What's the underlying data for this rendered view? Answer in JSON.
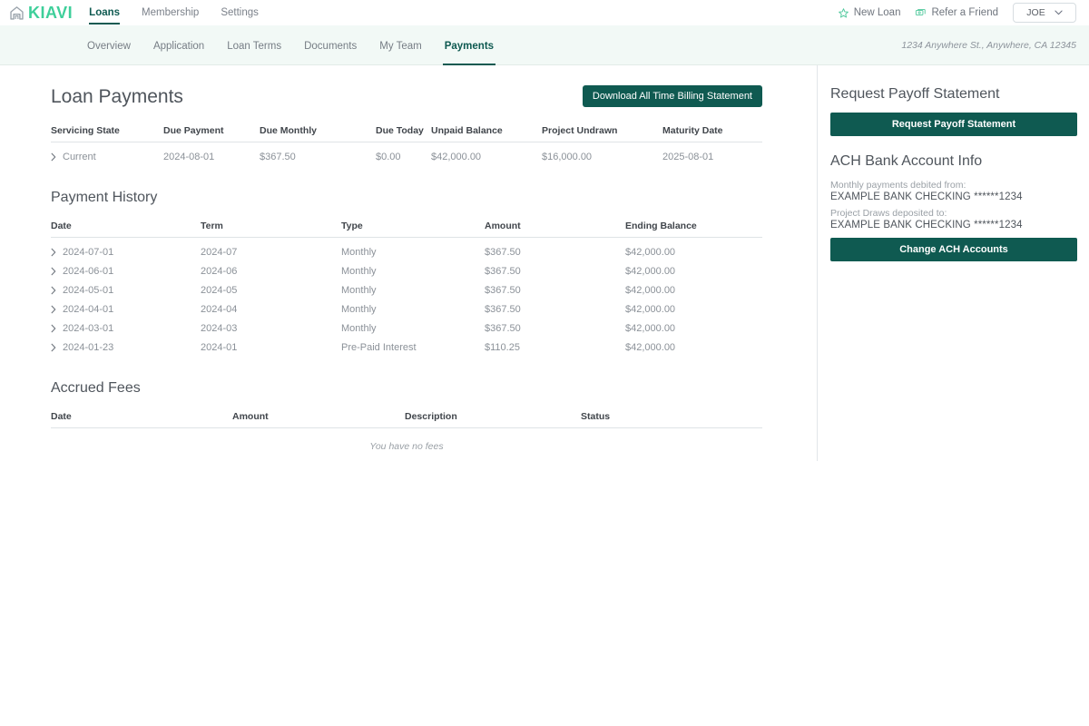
{
  "brand": {
    "logo_text": "KIAVI",
    "accent_green": "#3ecf9a",
    "teal": "#0f5a51",
    "subnav_bg": "#f2f9f6"
  },
  "topnav": {
    "items": [
      {
        "label": "Loans",
        "active": true
      },
      {
        "label": "Membership",
        "active": false
      },
      {
        "label": "Settings",
        "active": false
      }
    ],
    "actions": [
      {
        "label": "New Loan",
        "icon": "star-icon"
      },
      {
        "label": "Refer a Friend",
        "icon": "money-icon"
      }
    ],
    "user": {
      "name": "JOE",
      "icon": "chevron-down-icon"
    }
  },
  "subnav": {
    "items": [
      {
        "label": "Overview",
        "active": false
      },
      {
        "label": "Application",
        "active": false
      },
      {
        "label": "Loan Terms",
        "active": false
      },
      {
        "label": "Documents",
        "active": false
      },
      {
        "label": "My Team",
        "active": false
      },
      {
        "label": "Payments",
        "active": true
      }
    ],
    "address": "1234 Anywhere St., Anywhere, CA 12345"
  },
  "main": {
    "page_title": "Loan Payments",
    "download_button": "Download All Time Billing Statement",
    "summary": {
      "headers": [
        "Servicing State",
        "Due Payment",
        "Due Monthly",
        "Due Today",
        "Unpaid Balance",
        "Project Undrawn",
        "Maturity Date"
      ],
      "row": {
        "servicing_state": "Current",
        "due_payment": "2024-08-01",
        "due_monthly": "$367.50",
        "due_today": "$0.00",
        "unpaid_balance": "$42,000.00",
        "project_undrawn": "$16,000.00",
        "maturity_date": "2025-08-01"
      }
    },
    "payment_history": {
      "title": "Payment History",
      "headers": [
        "Date",
        "Term",
        "Type",
        "Amount",
        "Ending Balance"
      ],
      "rows": [
        {
          "date": "2024-07-01",
          "term": "2024-07",
          "type": "Monthly",
          "amount": "$367.50",
          "ending_balance": "$42,000.00"
        },
        {
          "date": "2024-06-01",
          "term": "2024-06",
          "type": "Monthly",
          "amount": "$367.50",
          "ending_balance": "$42,000.00"
        },
        {
          "date": "2024-05-01",
          "term": "2024-05",
          "type": "Monthly",
          "amount": "$367.50",
          "ending_balance": "$42,000.00"
        },
        {
          "date": "2024-04-01",
          "term": "2024-04",
          "type": "Monthly",
          "amount": "$367.50",
          "ending_balance": "$42,000.00"
        },
        {
          "date": "2024-03-01",
          "term": "2024-03",
          "type": "Monthly",
          "amount": "$367.50",
          "ending_balance": "$42,000.00"
        },
        {
          "date": "2024-01-23",
          "term": "2024-01",
          "type": "Pre-Paid Interest",
          "amount": "$110.25",
          "ending_balance": "$42,000.00"
        }
      ]
    },
    "accrued_fees": {
      "title": "Accrued Fees",
      "headers": [
        "Date",
        "Amount",
        "Description",
        "Status"
      ],
      "empty_message": "You have no fees"
    }
  },
  "sidebar": {
    "payoff": {
      "title": "Request Payoff Statement",
      "button": "Request Payoff Statement"
    },
    "ach": {
      "title": "ACH Bank Account Info",
      "debit_label": "Monthly payments debited from:",
      "debit_value": "EXAMPLE BANK CHECKING ******1234",
      "deposit_label": "Project Draws deposited to:",
      "deposit_value": "EXAMPLE BANK CHECKING ******1234",
      "button": "Change ACH Accounts"
    }
  }
}
